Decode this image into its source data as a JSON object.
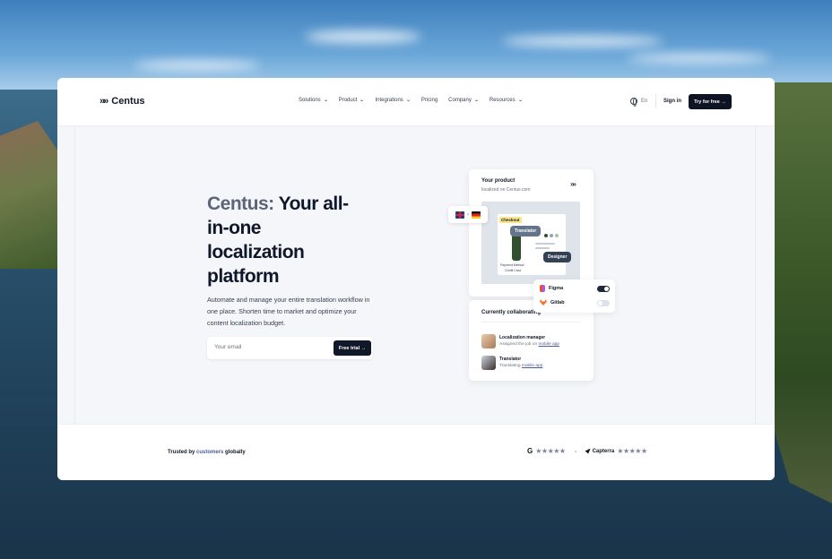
{
  "nav": {
    "logo_mark": "»",
    "logo_text": "Centus",
    "menu": [
      {
        "label": "Solutions",
        "has_dropdown": true
      },
      {
        "label": "Product",
        "has_dropdown": true
      },
      {
        "label": "Integrations",
        "has_dropdown": true
      },
      {
        "label": "Pricing",
        "has_dropdown": false
      },
      {
        "label": "Company",
        "has_dropdown": true
      },
      {
        "label": "Resources",
        "has_dropdown": true
      }
    ],
    "language": "En",
    "sign_in": "Sign in",
    "cta": "Try for free →"
  },
  "hero": {
    "title_accent": "Centus:",
    "title_rest": " Your all-in-one localization platform",
    "description": "Automate and manage your entire translation workflow in one place. Shorten time to market and optimize your content localization budget.",
    "email_placeholder": "Your email",
    "trial_button": "Free trial →"
  },
  "product_card": {
    "title": "Your product",
    "subtitle": "localized on Centus.com",
    "mark": "»",
    "checkout_tag": "Checkout",
    "translator_bubble": "Translator",
    "designer_bubble": "Designer",
    "flags_separator": "›",
    "mini_labels": [
      "Payment Method",
      "Credit Card"
    ]
  },
  "integrations": [
    {
      "name": "Figma",
      "enabled": true,
      "icon": "figma-icon"
    },
    {
      "name": "Gitlab",
      "enabled": false,
      "icon": "gitlab-icon"
    }
  ],
  "collab_card": {
    "title": "Currently collaborating",
    "people": [
      {
        "role": "Localization manager",
        "status_prefix": "Assigned the job on ",
        "link": "mobile app",
        "avatar_color": "#c9a27e"
      },
      {
        "role": "Translator",
        "status_prefix": "Translating ",
        "link": "mobile app",
        "avatar_color": "#8b6a55"
      }
    ]
  },
  "footer": {
    "trusted_prefix": "Trusted by ",
    "trusted_link": "customers",
    "trusted_suffix": " globally",
    "google_logo": "G",
    "capterra_label": "Capterra",
    "stars": "★★★★★"
  },
  "colors": {
    "dark": "#0f1424",
    "accent_text": "#5b6479",
    "link": "#4f5b9a",
    "star": "#7b849b"
  }
}
